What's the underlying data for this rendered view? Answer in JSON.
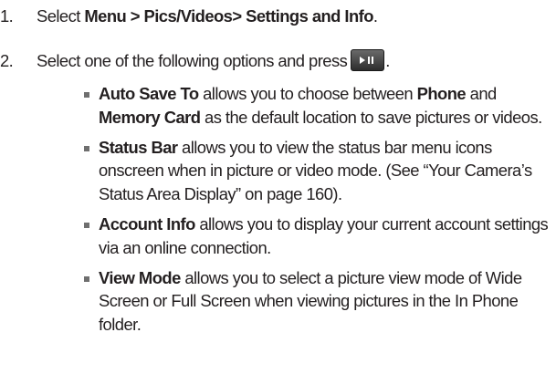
{
  "steps": [
    {
      "number": "1.",
      "prefix": "Select ",
      "bold": "Menu > Pics/Videos> Settings and Info",
      "suffix": "."
    },
    {
      "number": "2.",
      "text": "Select one of the following options and press",
      "key_icon": "play-pause-key-icon",
      "suffix": "."
    }
  ],
  "options": [
    {
      "term": "Auto Save To",
      "text_a": " allows you to choose between ",
      "bold_a": "Phone",
      "text_b": " and ",
      "bold_b": "Memory Card",
      "text_c": " as the default location to save pictures or videos."
    },
    {
      "term": "Status Bar",
      "text": " allows you to view the status bar menu icons onscreen when in picture or video mode. (See “Your Camera’s Status Area Display” on page 160)."
    },
    {
      "term": "Account Info",
      "text": " allows you to display your current account settings via an online connection."
    },
    {
      "term": "View Mode",
      "text": " allows you to select a picture view mode of Wide Screen or Full Screen when viewing pictures in the In Phone folder."
    }
  ]
}
